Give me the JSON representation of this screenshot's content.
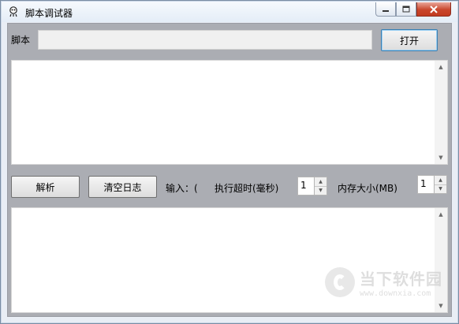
{
  "window": {
    "title": "脚本调试器",
    "icon": "app-icon",
    "controls": [
      "minimize-icon",
      "maximize-icon",
      "close-icon"
    ]
  },
  "script_row": {
    "label": "脚本",
    "value": "",
    "open_button": "打开"
  },
  "controls_row": {
    "parse_button": "解析",
    "clear_log_button": "清空日志",
    "input_label": "输入：(",
    "timeout_label": "执行超时(毫秒)",
    "timeout_value": "1",
    "memory_label": "内存大小(MB)",
    "memory_value": "1"
  },
  "watermark": {
    "name": "当下软件园",
    "url": "www.downxia.com"
  }
}
